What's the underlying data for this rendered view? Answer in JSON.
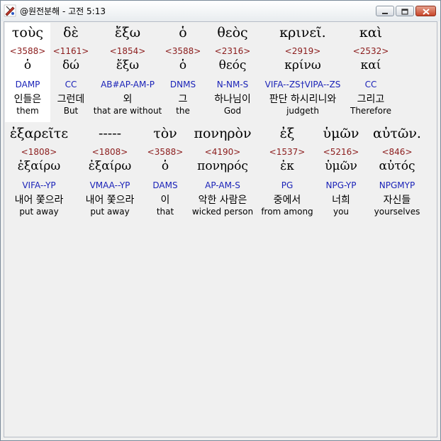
{
  "window": {
    "title": "@원전분해 - 고전 5:13"
  },
  "icons": {
    "app": "app-logo-icon",
    "minimize": "minimize-icon",
    "maximize": "maximize-icon",
    "close": "close-icon"
  },
  "rows": [
    {
      "words": [
        {
          "greek": "τοὺς",
          "strong": "<3588>",
          "lemma": "ὁ",
          "parse": "DAMP",
          "korean": "인들은",
          "english": "them"
        },
        {
          "greek": "δὲ",
          "strong": "<1161>",
          "lemma": "δώ",
          "parse": "CC",
          "korean": "그런데",
          "english": "But"
        },
        {
          "greek": "ἔξω",
          "strong": "<1854>",
          "lemma": "ἔξω",
          "parse": "AB#AP-AM-P",
          "korean": "외",
          "english": "that are without"
        },
        {
          "greek": "ὁ",
          "strong": "<3588>",
          "lemma": "ὁ",
          "parse": "DNMS",
          "korean": "그",
          "english": "the"
        },
        {
          "greek": "θεὸς",
          "strong": "<2316>",
          "lemma": "θεός",
          "parse": "N-NM-S",
          "korean": "하나님이",
          "english": "God"
        },
        {
          "greek": "κρινεῖ.",
          "strong": "<2919>",
          "lemma": "κρίνω",
          "parse": "VIFA--ZS†VIPA--ZS",
          "korean": "판단 하시리니와",
          "english": "judgeth"
        },
        {
          "greek": "καὶ",
          "strong": "<2532>",
          "lemma": "καί",
          "parse": "CC",
          "korean": "그리고",
          "english": "Therefore"
        }
      ]
    },
    {
      "words": [
        {
          "greek": "ἐξαρεῖτε",
          "strong": "<1808>",
          "lemma": "ἐξαίρω",
          "parse": "VIFA--YP",
          "korean": "내어 쫓으라",
          "english": "put away"
        },
        {
          "greek": "-----",
          "strong": "<1808>",
          "lemma": "ἐξαίρω",
          "parse": "VMAA--YP",
          "korean": "내어 쫓으라",
          "english": "put away"
        },
        {
          "greek": "τὸν",
          "strong": "<3588>",
          "lemma": "ὁ",
          "parse": "DAMS",
          "korean": "이",
          "english": "that"
        },
        {
          "greek": "πονηρὸν",
          "strong": "<4190>",
          "lemma": "πονηρός",
          "parse": "AP-AM-S",
          "korean": "악한 사람은",
          "english": "wicked person"
        },
        {
          "greek": "ἐξ",
          "strong": "<1537>",
          "lemma": "ἐκ",
          "parse": "PG",
          "korean": "중에서",
          "english": "from among"
        },
        {
          "greek": "ὑμῶν",
          "strong": "<5216>",
          "lemma": "ὑμῶν",
          "parse": "NPG-YP",
          "korean": "너희",
          "english": "you"
        },
        {
          "greek": "αὐτῶν.",
          "strong": "<846>",
          "lemma": "αὐτός",
          "parse": "NPGMYP",
          "korean": "자신들",
          "english": "yourselves"
        }
      ]
    }
  ]
}
